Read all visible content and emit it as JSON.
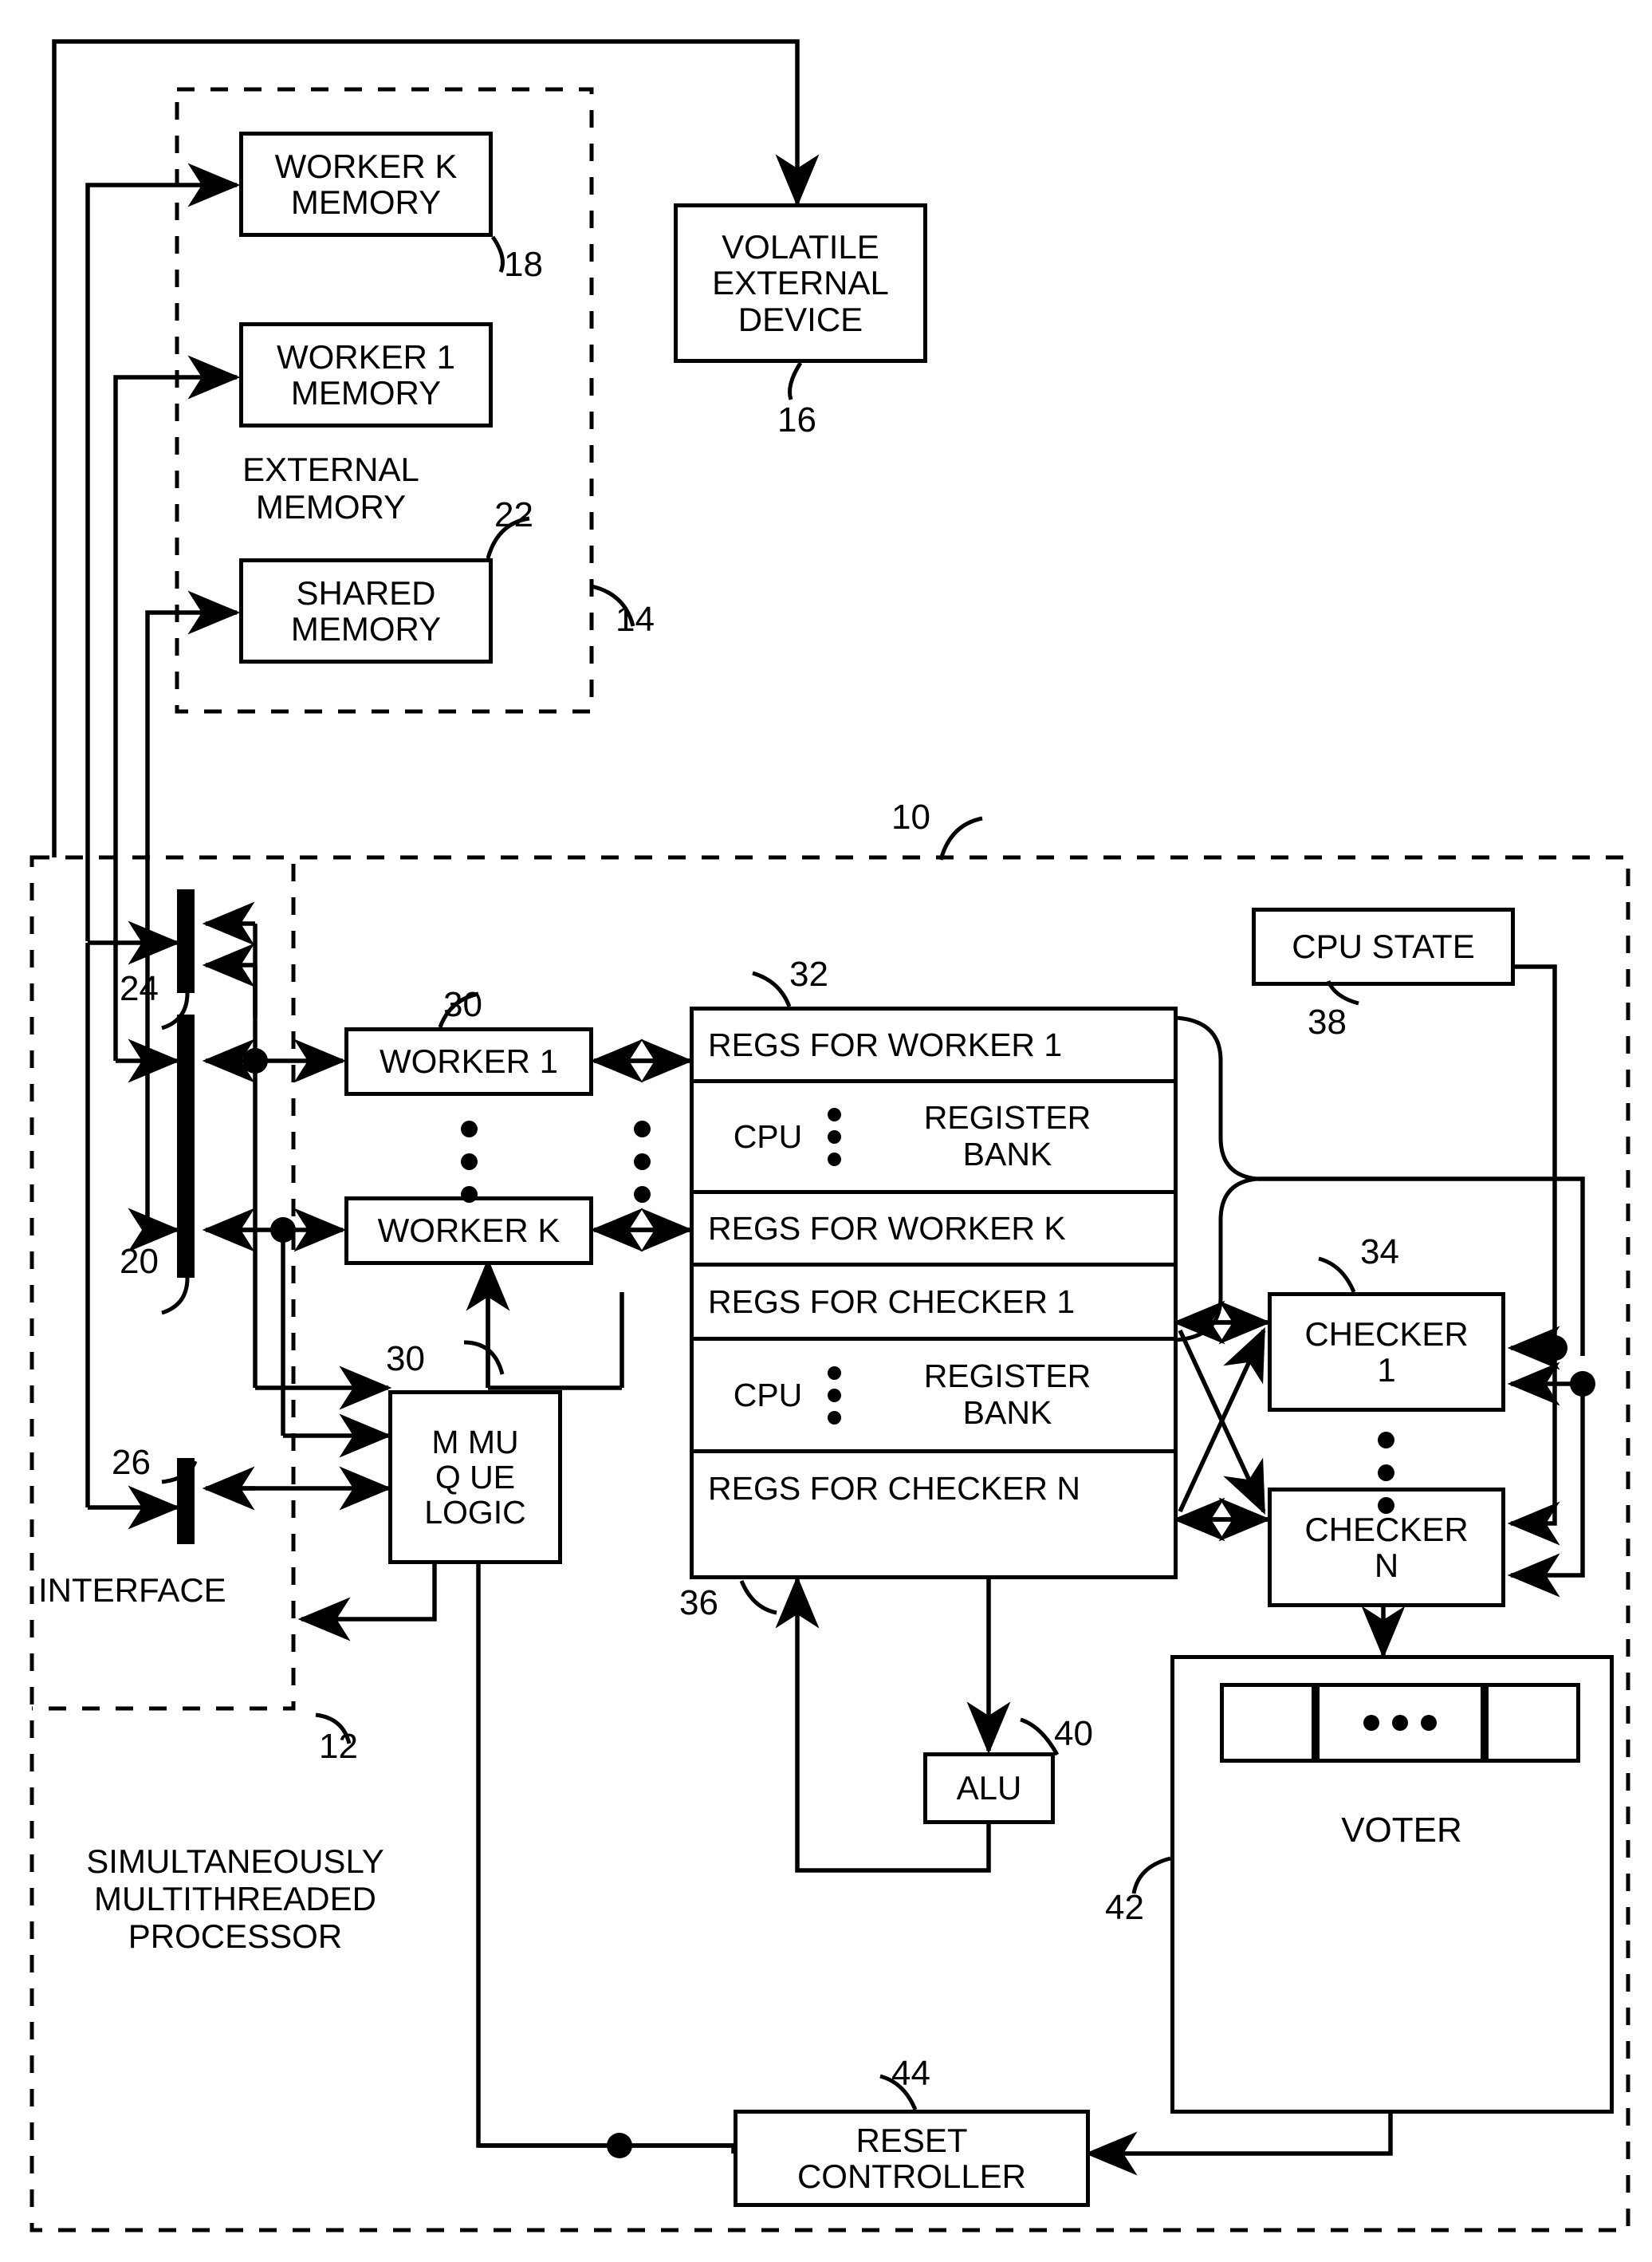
{
  "figure": {
    "title": "Simultaneously multithreaded processor with redundant execution checking",
    "type": "patent-block-diagram"
  },
  "boxes": {
    "worker_k_memory": "WORKER K\nMEMORY",
    "worker_1_memory": "WORKER 1\nMEMORY",
    "shared_memory": "SHARED\nMEMORY",
    "volatile_external_device": "VOLATILE\nEXTERNAL\nDEVICE",
    "worker_1": "WORKER 1",
    "worker_k": "WORKER K",
    "mmu_queue_logic": "M MU\nQ UE\nLOGIC",
    "cpu_state": "CPU STATE",
    "checker_1": "CHECKER\n1",
    "checker_n": "CHECKER\nN",
    "alu": "ALU",
    "reset_controller": "RESET\nCONTROLLER",
    "voter": "VOTER"
  },
  "register_bank": {
    "rows": [
      "REGS FOR WORKER 1",
      "REGS FOR WORKER K",
      "REGS FOR CHECKER 1",
      "REGS FOR CHECKER N"
    ],
    "cpu_label": "CPU",
    "bank_label": "REGISTER\nBANK"
  },
  "labels": {
    "external_memory": "EXTERNAL\nMEMORY",
    "interface": "INTERFACE",
    "processor": "SIMULTANEOUSLY\nMULTITHREADED\nPROCESSOR"
  },
  "ref_numbers": {
    "n10": "10",
    "n12": "12",
    "n14": "14",
    "n16": "16",
    "n18": "18",
    "n20": "20",
    "n22": "22",
    "n24": "24",
    "n26": "26",
    "n30_worker": "30",
    "n30_mmu": "30",
    "n32": "32",
    "n34": "34",
    "n36": "36",
    "n38": "38",
    "n40": "40",
    "n42": "42",
    "n44": "44"
  },
  "colors": {
    "line": "#000000",
    "background": "#ffffff"
  }
}
